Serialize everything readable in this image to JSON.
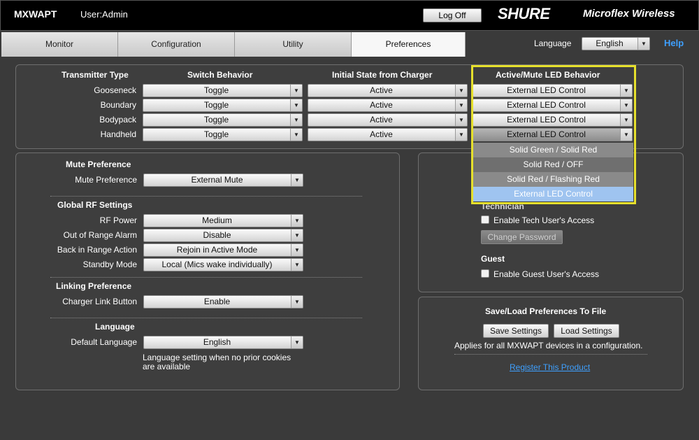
{
  "header": {
    "device": "MXWAPT",
    "user": "User:Admin",
    "logoff_label": "Log Off",
    "brand": "SHURE",
    "product": "Microflex Wireless"
  },
  "tabs": [
    {
      "label": "Monitor",
      "active": false
    },
    {
      "label": "Configuration",
      "active": false
    },
    {
      "label": "Utility",
      "active": false
    },
    {
      "label": "Preferences",
      "active": true
    }
  ],
  "language_bar": {
    "label": "Language",
    "value": "English",
    "help": "Help"
  },
  "transmitter_table": {
    "headers": [
      "Transmitter Type",
      "Switch Behavior",
      "Initial State from Charger",
      "Active/Mute LED Behavior"
    ],
    "rows": [
      {
        "type": "Gooseneck",
        "switch": "Toggle",
        "initial": "Active",
        "led": "External LED Control"
      },
      {
        "type": "Boundary",
        "switch": "Toggle",
        "initial": "Active",
        "led": "External LED Control"
      },
      {
        "type": "Bodypack",
        "switch": "Toggle",
        "initial": "Active",
        "led": "External LED Control"
      },
      {
        "type": "Handheld",
        "switch": "Toggle",
        "initial": "Active",
        "led": "External LED Control"
      }
    ]
  },
  "led_dropdown": {
    "options": [
      "Solid Green / Solid Red",
      "Solid Red / OFF",
      "Solid Red / Flashing Red",
      "External LED Control"
    ],
    "option_colors": [
      "#8a8a8a",
      "#6f6f6f",
      "#8a8a8a",
      "#9fc4f0"
    ],
    "highlight_color": "#e6e02c"
  },
  "left_panel": {
    "mute": {
      "title": "Mute Preference",
      "label": "Mute Preference",
      "value": "External Mute"
    },
    "rf": {
      "title": "Global RF Settings",
      "rows": [
        {
          "label": "RF Power",
          "value": "Medium"
        },
        {
          "label": "Out of Range Alarm",
          "value": "Disable"
        },
        {
          "label": "Back in Range Action",
          "value": "Rejoin in Active Mode"
        },
        {
          "label": "Standby Mode",
          "value": "Local (Mics wake individually)"
        }
      ]
    },
    "linking": {
      "title": "Linking Preference",
      "label": "Charger Link Button",
      "value": "Enable"
    },
    "language": {
      "title": "Language",
      "label": "Default Language",
      "value": "English",
      "note_line1": "Language setting when no prior cookies",
      "note_line2": "are available"
    }
  },
  "access_panel": {
    "technician_title": "Technician",
    "tech_checkbox": "Enable Tech User's Access",
    "change_password": "Change Password",
    "guest_title": "Guest",
    "guest_checkbox": "Enable Guest User's Access"
  },
  "file_panel": {
    "title": "Save/Load Preferences To File",
    "save": "Save Settings",
    "load": "Load Settings",
    "note": "Applies for all MXWAPT devices in a configuration.",
    "register": "Register This Product"
  },
  "colors": {
    "accent_link": "#3ea0ff",
    "background": "#3a3a3a",
    "header": "#000000"
  }
}
